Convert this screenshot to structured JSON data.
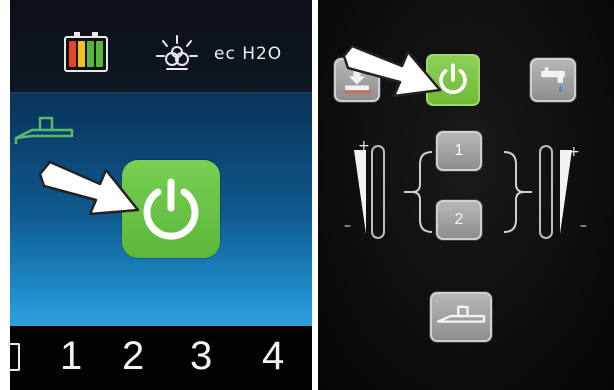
{
  "left_display": {
    "status": {
      "battery_icon": "battery-icon",
      "battery_cell_colors": [
        "#e8442b",
        "#f0c21c",
        "#57b83b",
        "#57b83b"
      ],
      "lamp_icon": "work-light-icon",
      "eco_label": "ec H2O"
    },
    "squeegee_icon": "squeegee-icon",
    "power_button_icon": "power-icon",
    "pointer_icon": "arrow-pointer-icon",
    "bottom_menu": [
      "1",
      "2",
      "3",
      "4"
    ]
  },
  "right_panel": {
    "keys": {
      "brush_pressure_icon": "brush-pressure-icon",
      "power_icon": "power-icon",
      "water_icon": "water-tap-icon",
      "squeegee_icon": "squeegee-icon",
      "mode_1": "1",
      "mode_2": "2"
    },
    "left_scale": {
      "plus": "+",
      "minus": "–"
    },
    "right_scale": {
      "plus": "+",
      "minus": "–"
    },
    "pointer_icon": "arrow-pointer-icon"
  },
  "colors": {
    "power_green": "#6fbb36",
    "key_gray": "#9a9a9a"
  }
}
